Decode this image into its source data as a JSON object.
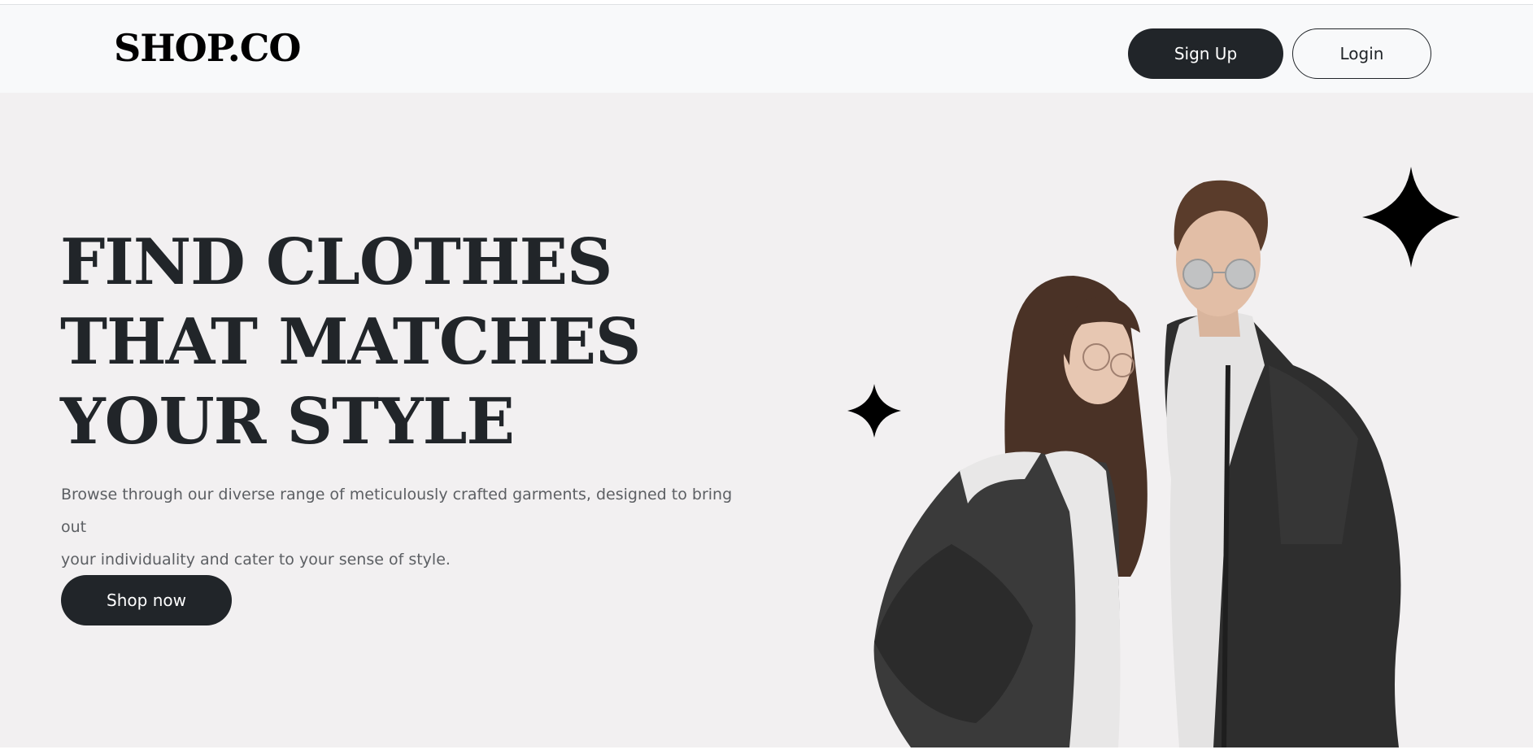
{
  "brand": {
    "logo": "SHOP.CO"
  },
  "nav": {
    "signup_label": "Sign Up",
    "login_label": "Login"
  },
  "hero": {
    "headline_lines": [
      "FIND CLOTHES",
      "THAT MATCHES",
      "YOUR STYLE"
    ],
    "description_line1": "Browse through our diverse range of meticulously crafted garments, designed to bring out",
    "description_line2": "your individuality and cater to your sense of style.",
    "cta_label": "Shop now"
  },
  "colors": {
    "dark": "#212529",
    "hero_bg": "#f2f0f1",
    "navbar_bg": "#f8f9fa"
  },
  "icons": [
    "sparkle-star-icon",
    "sparkle-star-icon"
  ]
}
